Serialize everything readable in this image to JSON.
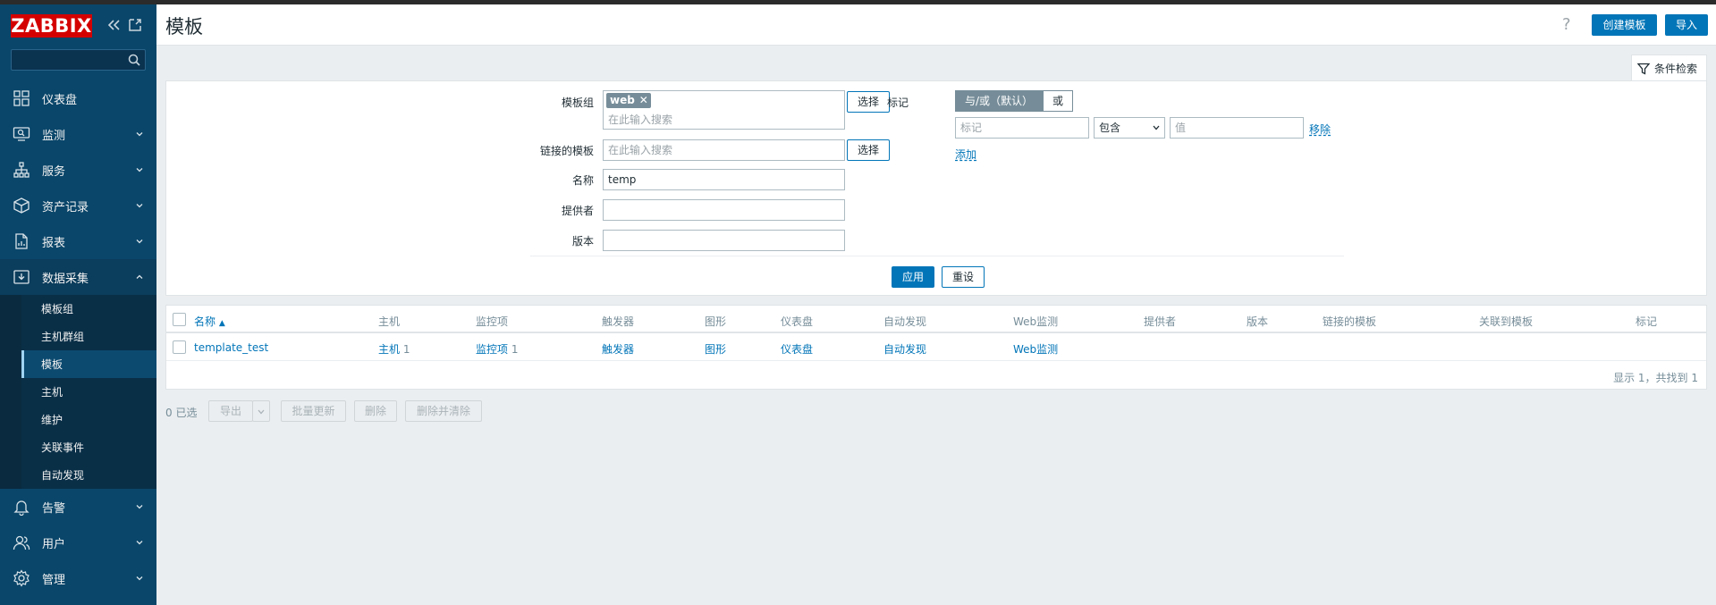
{
  "logo": {
    "text": "ZABBIX"
  },
  "sidebar": {
    "nav": [
      {
        "label": "仪表盘",
        "icon": "dashboard-icon"
      },
      {
        "label": "监测",
        "icon": "monitoring-icon"
      },
      {
        "label": "服务",
        "icon": "services-icon"
      },
      {
        "label": "资产记录",
        "icon": "inventory-icon"
      },
      {
        "label": "报表",
        "icon": "reports-icon"
      },
      {
        "label": "数据采集",
        "icon": "data-collection-icon"
      }
    ],
    "sub": [
      {
        "label": "模板组"
      },
      {
        "label": "主机群组"
      },
      {
        "label": "模板"
      },
      {
        "label": "主机"
      },
      {
        "label": "维护"
      },
      {
        "label": "关联事件"
      },
      {
        "label": "自动发现"
      }
    ],
    "nav_bottom": [
      {
        "label": "告警",
        "icon": "bell-icon"
      },
      {
        "label": "用户",
        "icon": "users-icon"
      },
      {
        "label": "管理",
        "icon": "gear-icon"
      }
    ]
  },
  "header": {
    "title": "模板",
    "help": "?",
    "create_label": "创建模板",
    "import_label": "导入"
  },
  "filter": {
    "tab_label": "条件检索",
    "template_group_label": "模板组",
    "template_group_chip": "web",
    "search_placeholder": "在此输入搜索",
    "select_label": "选择",
    "linked_templates_label": "链接的模板",
    "name_label": "名称",
    "name_value": "temp",
    "vendor_label": "提供者",
    "vendor_value": "",
    "version_label": "版本",
    "version_value": "",
    "tags_label": "标记",
    "tags_and_or": "与/或（默认）",
    "tags_or": "或",
    "tag_placeholder": "标记",
    "tag_operator": "包含",
    "value_placeholder": "值",
    "remove_label": "移除",
    "add_label": "添加",
    "apply_label": "应用",
    "reset_label": "重设"
  },
  "table": {
    "headers": {
      "name": "名称",
      "sort": "▲",
      "hosts": "主机",
      "items": "监控项",
      "triggers": "触发器",
      "graphs": "图形",
      "dashboards": "仪表盘",
      "discovery": "自动发现",
      "web": "Web监测",
      "vendor": "提供者",
      "version": "版本",
      "linked": "链接的模板",
      "linked_to": "关联到模板",
      "tags": "标记"
    },
    "row": {
      "name": "template_test",
      "hosts": "主机",
      "hosts_count": "1",
      "items": "监控项",
      "items_count": "1",
      "triggers": "触发器",
      "graphs": "图形",
      "dashboards": "仪表盘",
      "discovery": "自动发现",
      "web": "Web监测"
    },
    "footer": "显示 1，共找到 1"
  },
  "actions": {
    "selected": "0 已选",
    "export": "导出",
    "mass_update": "批量更新",
    "delete": "删除",
    "delete_clear": "删除并清除"
  }
}
